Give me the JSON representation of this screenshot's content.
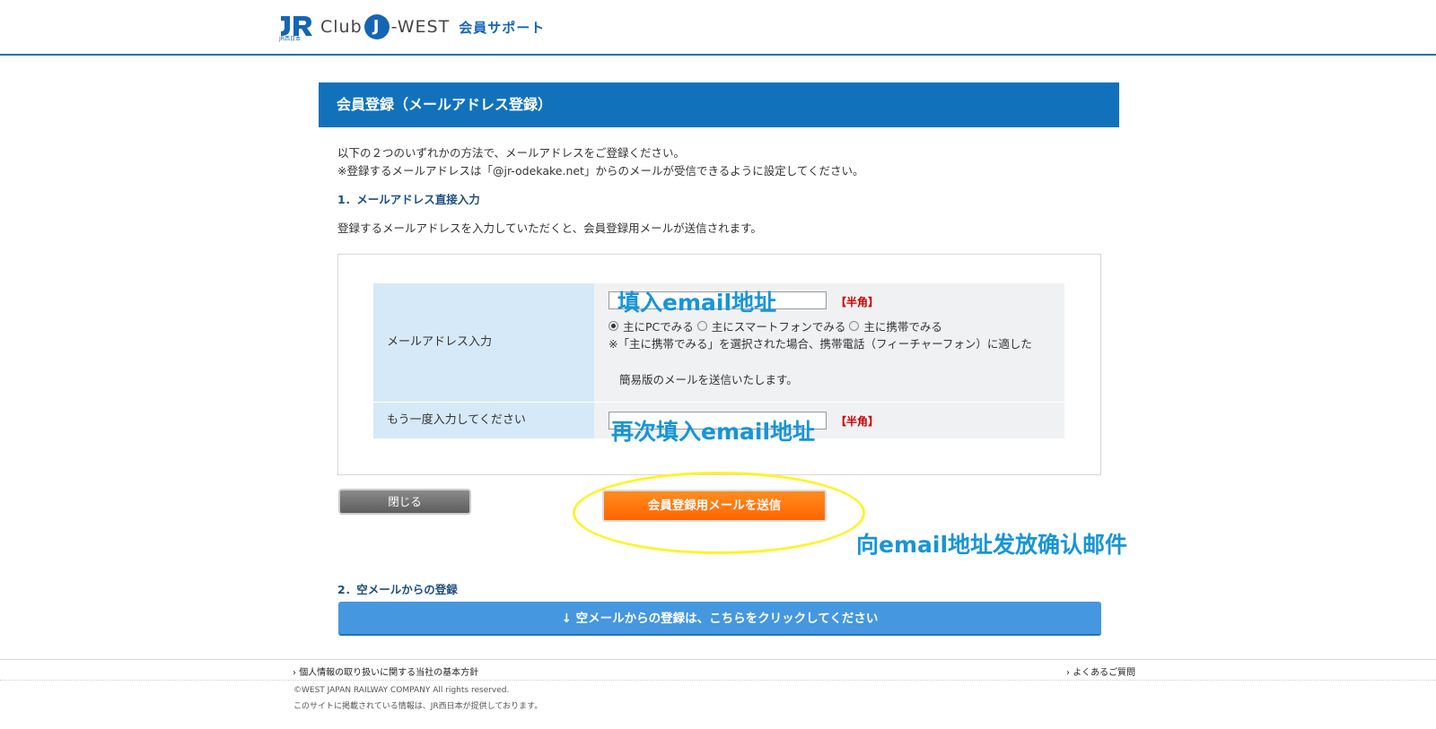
{
  "header": {
    "logo_club": "Club",
    "logo_j": "J",
    "logo_west": "-WEST",
    "logo_support": "会員サポート",
    "logo_jr_sub": "JR西日本"
  },
  "page_title": "会員登録（メールアドレス登録）",
  "intro": {
    "line1": "以下の２つのいずれかの方法で、メールアドレスをご登録ください。",
    "line2": "※登録するメールアドレスは「@jr-odekake.net」からのメールが受信できるように設定してください。"
  },
  "section1": {
    "heading": "1．メールアドレス直接入力",
    "description": "登録するメールアドレスを入力していただくと、会員登録用メールが送信されます。"
  },
  "form": {
    "email_label": "メールアドレス入力",
    "email_value": "",
    "hankaku": "【半角】",
    "radios": [
      {
        "label": "主にPCでみる",
        "checked": true
      },
      {
        "label": "主にスマートフォンでみる",
        "checked": false
      },
      {
        "label": "主に携帯でみる",
        "checked": false
      }
    ],
    "note_line1": "※「主に携帯でみる」を選択された場合、携帯電話（フィーチャーフォン）に適した",
    "note_line2": "簡易版のメールを送信いたします。",
    "confirm_label": "もう一度入力してください",
    "confirm_value": ""
  },
  "annotations": {
    "a1": "填入email地址",
    "a2": "再次填入email地址",
    "a3": "向email地址发放确认邮件"
  },
  "buttons": {
    "close": "閉じる",
    "send": "会員登録用メールを送信"
  },
  "section2": {
    "heading": "2．空メールからの登録",
    "button": "↓ 空メールからの登録は、こちらをクリックしてください"
  },
  "footer": {
    "privacy_link": "個人情報の取り扱いに関する当社の基本方針",
    "faq_link": "よくあるご質問",
    "copyright": "©WEST JAPAN RAILWAY COMPANY All rights reserved.",
    "info": "このサイトに掲載されている情報は、JR西日本が提供しております。"
  },
  "colors": {
    "brand_blue": "#1172bb",
    "label_bg": "#d6e9f8",
    "send_orange": "#ff6600",
    "annotation_blue": "#1795d6",
    "highlight_yellow": "#fdf428"
  }
}
